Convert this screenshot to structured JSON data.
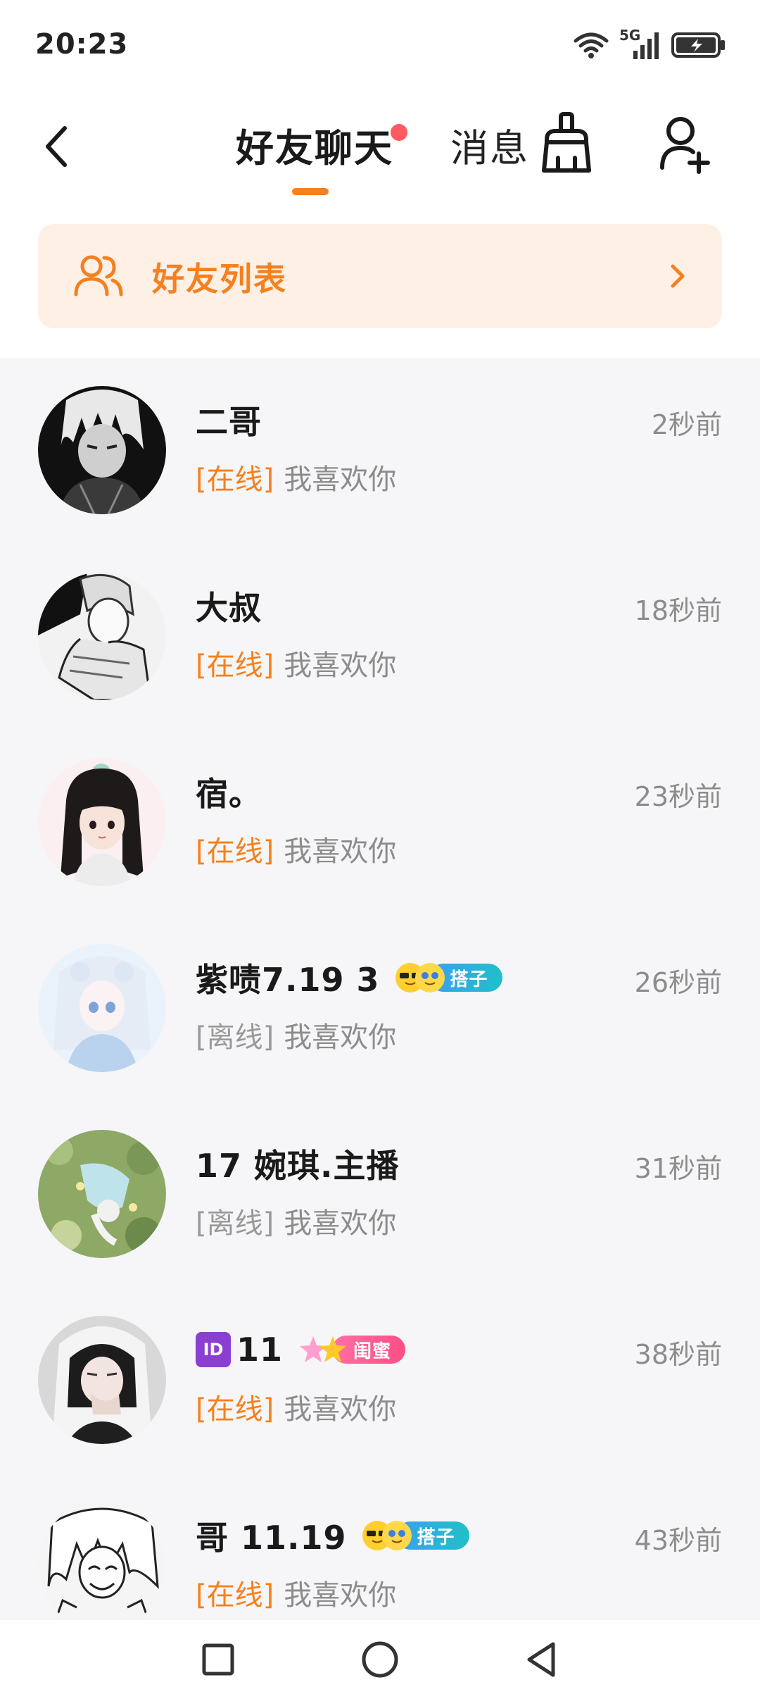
{
  "status_bar": {
    "time": "20:23",
    "network": "5G"
  },
  "header": {
    "tabs": [
      {
        "label": "好友聊天",
        "active": true,
        "has_dot": true
      },
      {
        "label": "消息",
        "active": false
      }
    ],
    "icons": [
      "back-icon",
      "clean-icon",
      "add-friend-icon"
    ]
  },
  "friend_list_banner": {
    "label": "好友列表"
  },
  "chats": [
    {
      "name": "二哥",
      "status": "[在线]",
      "online": true,
      "message": "我喜欢你",
      "time": "2秒前"
    },
    {
      "name": "大叔",
      "status": "[在线]",
      "online": true,
      "message": "我喜欢你",
      "time": "18秒前"
    },
    {
      "name": "宿。",
      "status": "[在线]",
      "online": true,
      "message": "我喜欢你",
      "time": "23秒前"
    },
    {
      "name": "紫啧7.19 3",
      "status": "[离线]",
      "online": false,
      "message": "我喜欢你",
      "time": "26秒前",
      "tag": "搭子"
    },
    {
      "name": "17 婉琪.主播",
      "status": "[离线]",
      "online": false,
      "message": "我喜欢你",
      "time": "31秒前"
    },
    {
      "name": "11",
      "id_badge": "ID",
      "status": "[在线]",
      "online": true,
      "message": "我喜欢你",
      "time": "38秒前",
      "tag": "闺蜜"
    },
    {
      "name": "哥 11.19",
      "status": "[在线]",
      "online": true,
      "message": "我喜欢你",
      "time": "43秒前",
      "tag": "搭子"
    }
  ],
  "colors": {
    "accent": "#f5801e",
    "banner_bg": "#fff0e6",
    "list_bg": "#f6f6f8",
    "dot": "#ff5a5f"
  },
  "nav_bar": {
    "icons": [
      "recent-apps-icon",
      "home-icon",
      "back-nav-icon"
    ]
  }
}
